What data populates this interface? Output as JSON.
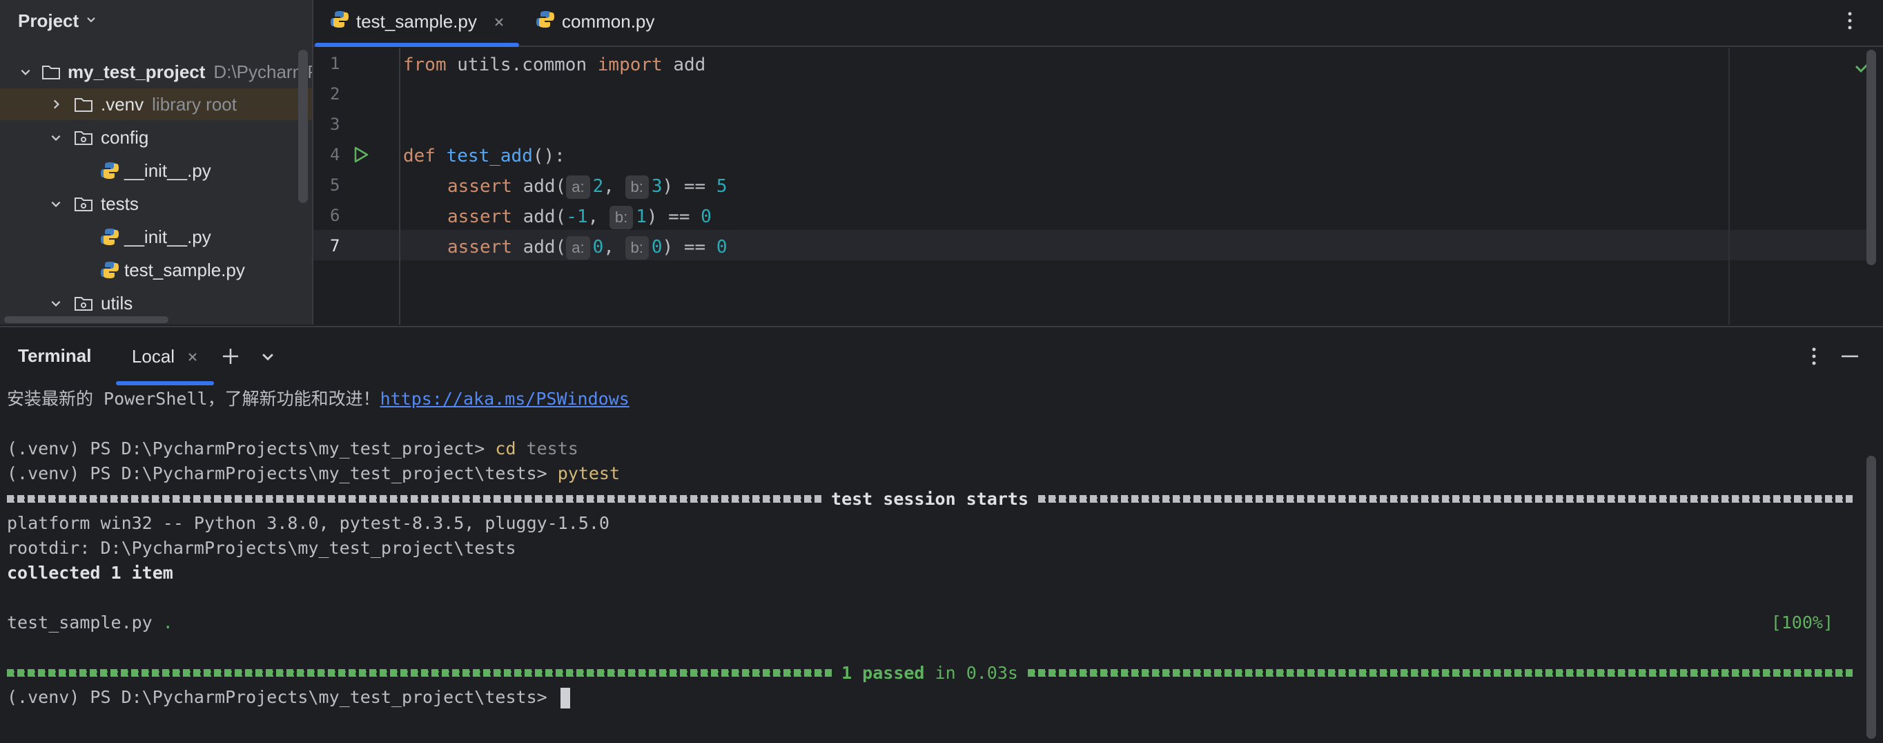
{
  "project_panel": {
    "title": "Project",
    "tree": [
      {
        "label": "my_test_project",
        "extra": "D:\\PycharmP",
        "kind": "folder"
      },
      {
        "label": ".venv",
        "extra": "library root",
        "kind": "folder"
      },
      {
        "label": "config",
        "kind": "package"
      },
      {
        "label": "__init__.py",
        "kind": "python"
      },
      {
        "label": "tests",
        "kind": "package"
      },
      {
        "label": "__init__.py",
        "kind": "python"
      },
      {
        "label": "test_sample.py",
        "kind": "python"
      },
      {
        "label": "utils",
        "kind": "package"
      }
    ]
  },
  "editor": {
    "tabs": [
      {
        "label": "test_sample.py",
        "active": true
      },
      {
        "label": "common.py",
        "active": false
      }
    ],
    "line_numbers": [
      "1",
      "2",
      "3",
      "4",
      "5",
      "6",
      "7"
    ],
    "code": {
      "l1": {
        "kw1": "from",
        "mod": " utils.common ",
        "kw2": "import",
        "name": " add"
      },
      "l4": {
        "kw": "def",
        "fn": "test_add",
        "rest": "():"
      },
      "l5": {
        "kw": "assert",
        "call": " add(",
        "h1": "a:",
        "v1": "2",
        "sep": ", ",
        "h2": "b:",
        "v2": "3",
        "close": ") == ",
        "res": "5"
      },
      "l6": {
        "kw": "assert",
        "call": " add(",
        "v1": "-1",
        "sep": ", ",
        "h2": "b:",
        "v2": "1",
        "close": ") == ",
        "res": "0"
      },
      "l7": {
        "kw": "assert",
        "call": " add(",
        "h1": "a:",
        "v1": "0",
        "sep": ", ",
        "h2": "b:",
        "v2": "0",
        "close": ") == ",
        "res": "0"
      }
    }
  },
  "terminal": {
    "title": "Terminal",
    "tab_label": "Local",
    "lines": {
      "install_msg": "安装最新的 PowerShell，了解新功能和改进！",
      "install_link": "https://aka.ms/PSWindows",
      "prompt1": "(.venv) PS D:\\PycharmProjects\\my_test_project> ",
      "cmd1_a": "cd",
      "cmd1_b": " tests",
      "prompt2": "(.venv) PS D:\\PycharmProjects\\my_test_project\\tests> ",
      "cmd2": "pytest",
      "session_starts": "test session starts",
      "platform": "platform win32 -- Python 3.8.0, pytest-8.3.5, pluggy-1.5.0",
      "rootdir": "rootdir: D:\\PycharmProjects\\my_test_project\\tests",
      "collected": "collected 1 item",
      "test_file": "test_sample.py",
      "test_dot": " .",
      "percent": "[100%]",
      "passed": "1 passed",
      "duration": " in 0.03s",
      "prompt3": "(.venv) PS D:\\PycharmProjects\\my_test_project\\tests> "
    }
  },
  "colors": {
    "background": "#1e1f22",
    "panel": "#2b2d30",
    "accent": "#3574f0",
    "keyword": "#cf8e6d",
    "function": "#56a8f5",
    "number": "#2aacb8",
    "pass_green": "#5fb05f",
    "command_yellow": "#d5b778"
  }
}
